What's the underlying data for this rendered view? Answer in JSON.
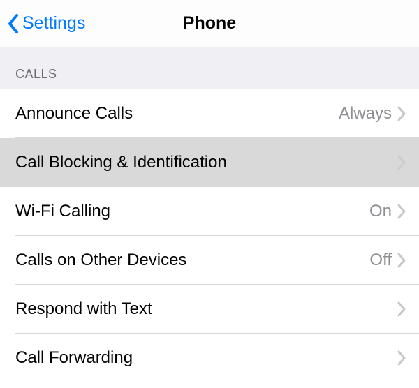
{
  "nav": {
    "back_label": "Settings",
    "title": "Phone"
  },
  "section": {
    "header": "CALLS",
    "rows": [
      {
        "label": "Announce Calls",
        "value": "Always",
        "highlight": false
      },
      {
        "label": "Call Blocking & Identification",
        "value": "",
        "highlight": true
      },
      {
        "label": "Wi-Fi Calling",
        "value": "On",
        "highlight": false
      },
      {
        "label": "Calls on Other Devices",
        "value": "Off",
        "highlight": false
      },
      {
        "label": "Respond with Text",
        "value": "",
        "highlight": false
      },
      {
        "label": "Call Forwarding",
        "value": "",
        "highlight": false
      }
    ]
  }
}
